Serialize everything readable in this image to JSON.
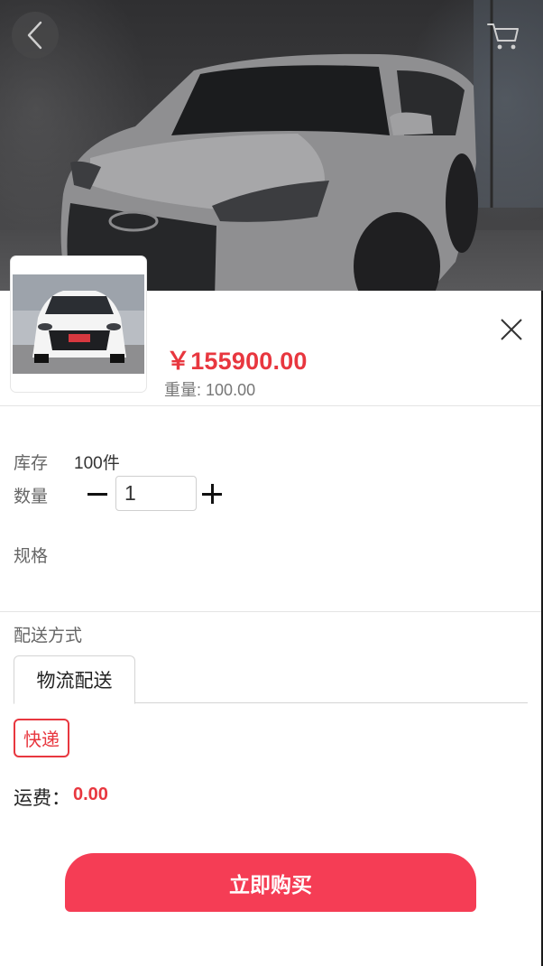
{
  "header": {
    "back_icon": "chevron-left-icon",
    "cart_icon": "cart-icon"
  },
  "product": {
    "image_alt": "white SUV product photo",
    "price": "￥155900.00",
    "weight_label": "重量:",
    "weight_value": "100.00"
  },
  "stock": {
    "label": "库存",
    "value": "100件"
  },
  "quantity": {
    "label": "数量",
    "value": "1"
  },
  "spec": {
    "label": "规格"
  },
  "delivery": {
    "label": "配送方式",
    "tab_label": "物流配送",
    "option_label": "快递"
  },
  "freight": {
    "label": "运费：",
    "value": "0.00"
  },
  "buy_button": {
    "label": "立即购买"
  },
  "colors": {
    "accent_red": "#e8373f",
    "button_red": "#f53d55"
  }
}
